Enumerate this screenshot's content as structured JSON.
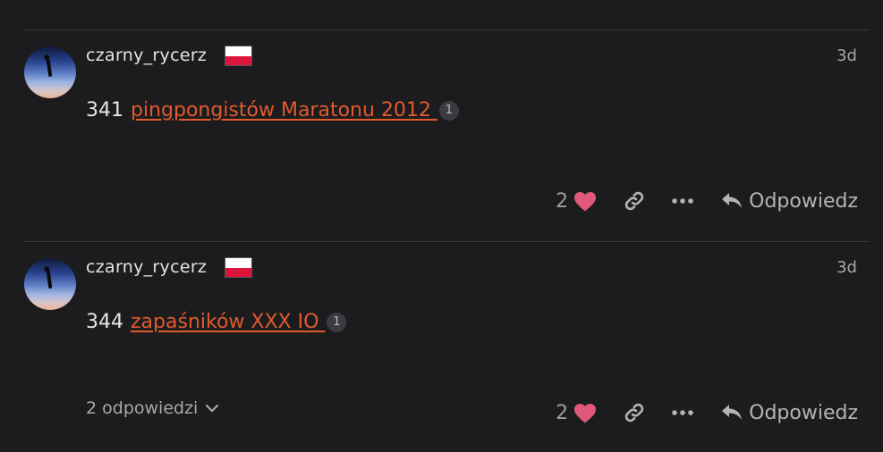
{
  "posts": [
    {
      "username": "czarny_rycerz",
      "time": "3d",
      "number": "341",
      "link_text": "pingpongistów Maratonu 2012 ",
      "link_clicks": "1",
      "likes": "2",
      "reply_label": "Odpowiedz"
    },
    {
      "username": "czarny_rycerz",
      "time": "3d",
      "number": "344",
      "link_text": "zapaśników XXX IO ",
      "link_clicks": "1",
      "likes": "2",
      "reply_label": "Odpowiedz",
      "replies_toggle": "2 odpowiedzi"
    }
  ],
  "colors": {
    "background": "#1c1c1f",
    "link": "#e05a2b",
    "heart": "#e0587c",
    "flag_white": "#ffffff",
    "flag_red": "#dc143c"
  },
  "icons": {
    "like": "heart-icon",
    "share": "link-icon",
    "more": "ellipsis-icon",
    "reply": "reply-arrow-icon",
    "expand": "chevron-down-icon"
  }
}
